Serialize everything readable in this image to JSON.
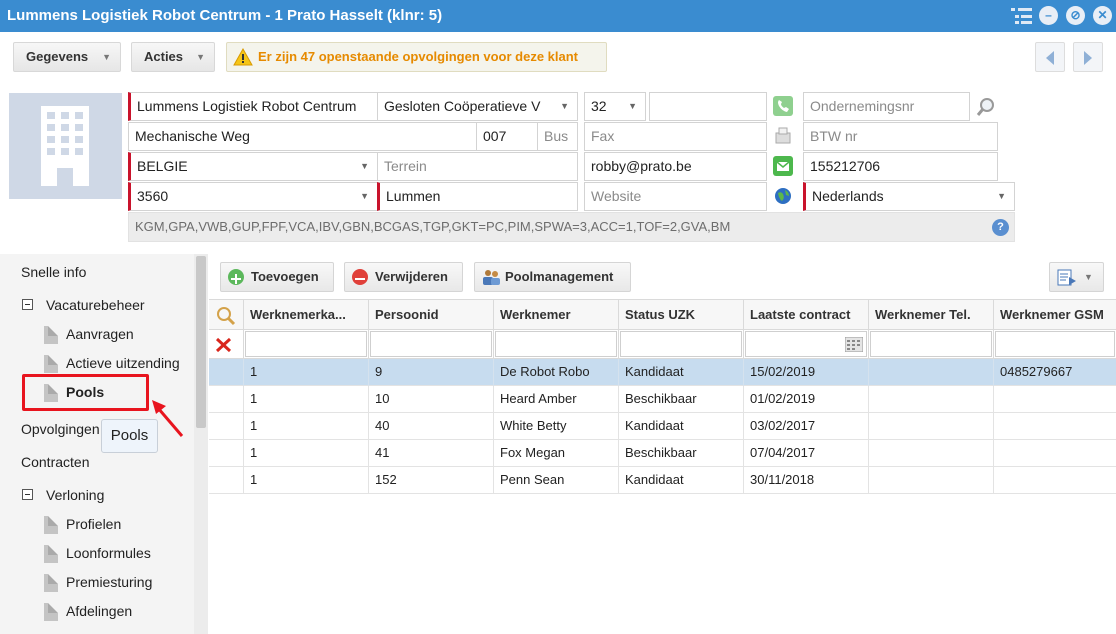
{
  "window": {
    "title": "Lummens Logistiek Robot Centrum - 1 Prato Hasselt (klnr: 5)"
  },
  "toolbar": {
    "gegevens_label": "Gegevens",
    "acties_label": "Acties",
    "warning_text": "Er zijn 47 openstaande opvolgingen voor deze klant"
  },
  "form": {
    "name": "Lummens Logistiek Robot Centrum",
    "legal_form": "Gesloten Coöperatieve V",
    "legal_code": "32",
    "phone": "",
    "company_number_placeholder": "Ondernemingsnr",
    "street": "Mechanische Weg",
    "number": "007",
    "bus_placeholder": "Bus",
    "fax_placeholder": "Fax",
    "vat_placeholder": "BTW nr",
    "country": "BELGIE",
    "terrain_placeholder": "Terrein",
    "email": "robby@prato.be",
    "sms": "155212706",
    "postal_code": "3560",
    "city": "Lummen",
    "website_placeholder": "Website",
    "language": "Nederlands",
    "tags": "KGM,GPA,VWB,GUP,FPF,VCA,IBV,GBN,BCGAS,TGP,GKT=PC,PIM,SPWA=3,ACC=1,TOF=2,GVA,BM"
  },
  "sidebar": {
    "items": [
      {
        "label": "Snelle info"
      },
      {
        "label": "Vacaturebeheer"
      },
      {
        "label": "Aanvragen"
      },
      {
        "label": "Actieve uitzending"
      },
      {
        "label": "Pools"
      },
      {
        "label": "Opvolgingen"
      },
      {
        "label": "Contracten"
      },
      {
        "label": "Verloning"
      },
      {
        "label": "Profielen"
      },
      {
        "label": "Loonformules"
      },
      {
        "label": "Premiesturing"
      },
      {
        "label": "Afdelingen"
      }
    ],
    "tooltip": "Pools"
  },
  "grid_toolbar": {
    "add_label": "Toevoegen",
    "remove_label": "Verwijderen",
    "pool_label": "Poolmanagement"
  },
  "grid": {
    "columns": [
      "Werknemerka...",
      "Persoonid",
      "Werknemer",
      "Status UZK",
      "Laatste contract",
      "Werknemer Tel.",
      "Werknemer GSM"
    ],
    "rows": [
      [
        "1",
        "9",
        "De Robot Robo",
        "Kandidaat",
        "15/02/2019",
        "",
        "0485279667"
      ],
      [
        "1",
        "10",
        "Heard Amber",
        "Beschikbaar",
        "01/02/2019",
        "",
        ""
      ],
      [
        "1",
        "40",
        "White Betty",
        "Kandidaat",
        "03/02/2017",
        "",
        ""
      ],
      [
        "1",
        "41",
        "Fox Megan",
        "Beschikbaar",
        "07/04/2017",
        "",
        ""
      ],
      [
        "1",
        "152",
        "Penn Sean",
        "Kandidaat",
        "30/11/2018",
        "",
        ""
      ]
    ]
  },
  "colors": {
    "title_bar": "#3a8cd0",
    "required": "#c9132c",
    "selected_row": "#c7dcef",
    "warning": "#e68a00",
    "highlight": "#e8141e"
  }
}
